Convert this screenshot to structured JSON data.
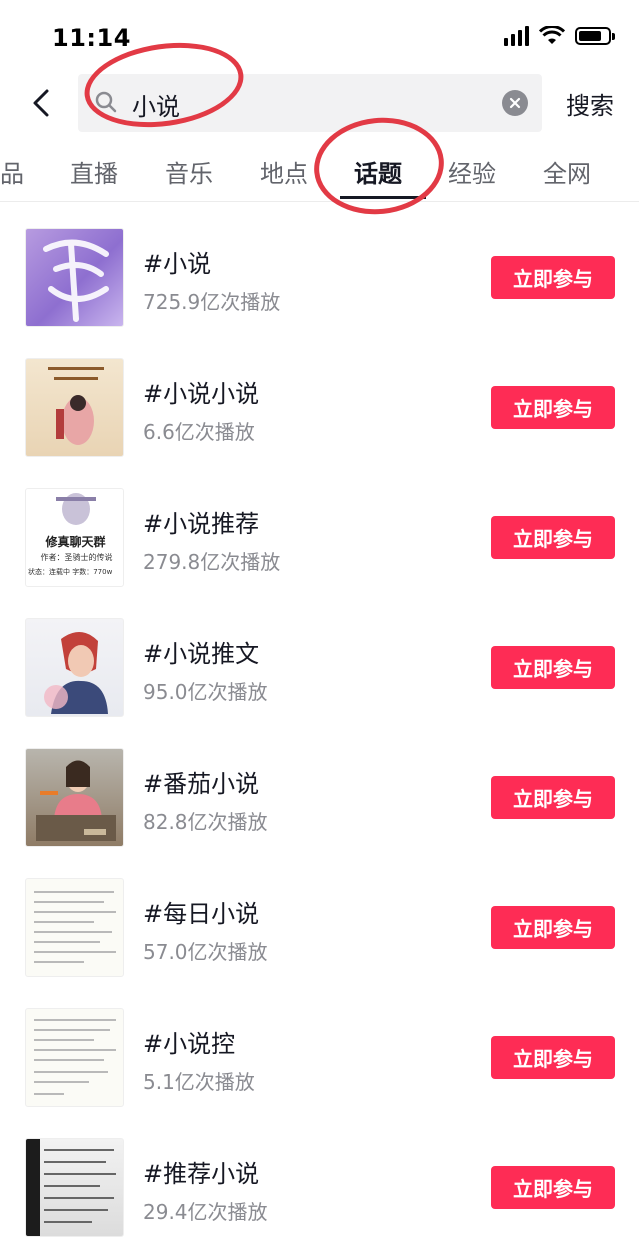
{
  "status_bar": {
    "time": "11:14"
  },
  "search": {
    "query": "小说",
    "submit_label": "搜索"
  },
  "tabs": [
    {
      "label": "品",
      "active": false
    },
    {
      "label": "直播",
      "active": false
    },
    {
      "label": "音乐",
      "active": false
    },
    {
      "label": "地点",
      "active": false
    },
    {
      "label": "话题",
      "active": true
    },
    {
      "label": "经验",
      "active": false
    },
    {
      "label": "全网",
      "active": false
    }
  ],
  "topics": [
    {
      "name": "#小说",
      "plays": "725.9亿次播放",
      "button": "立即参与"
    },
    {
      "name": "#小说小说",
      "plays": "6.6亿次播放",
      "button": "立即参与"
    },
    {
      "name": "#小说推荐",
      "plays": "279.8亿次播放",
      "button": "立即参与"
    },
    {
      "name": "#小说推文",
      "plays": "95.0亿次播放",
      "button": "立即参与"
    },
    {
      "name": "#番茄小说",
      "plays": "82.8亿次播放",
      "button": "立即参与"
    },
    {
      "name": "#每日小说",
      "plays": "57.0亿次播放",
      "button": "立即参与"
    },
    {
      "name": "#小说控",
      "plays": "5.1亿次播放",
      "button": "立即参与"
    },
    {
      "name": "#推荐小说",
      "plays": "29.4亿次播放",
      "button": "立即参与"
    }
  ],
  "thumb_texts": {
    "t3_title": "修真聊天群",
    "t3_author": "作者：圣骑士的传说",
    "t3_status": "状态：连载中    字数：770w"
  },
  "colors": {
    "accent": "#fe2c55",
    "annotation": "#e23a45",
    "text": "#161823",
    "muted": "#8a8b91"
  }
}
